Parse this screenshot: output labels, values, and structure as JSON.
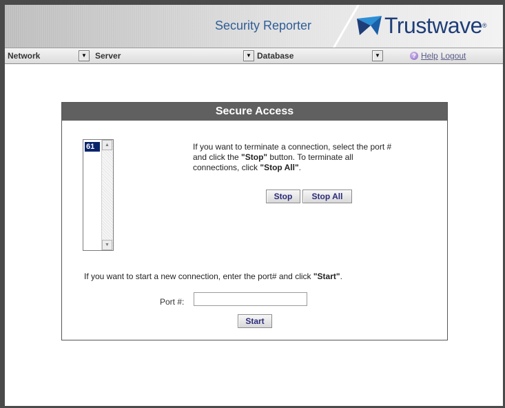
{
  "header": {
    "product_title": "Security Reporter",
    "brand": "Trustwave",
    "brand_mark": "trustwave-logo-mark",
    "brand_color": "#1e3e78"
  },
  "nav": {
    "menus": [
      {
        "label": "Network"
      },
      {
        "label": "Server"
      },
      {
        "label": "Database"
      }
    ],
    "help_label": "Help",
    "logout_label": "Logout"
  },
  "panel": {
    "title": "Secure Access",
    "connections": [
      "61"
    ],
    "instruction_parts": {
      "p1": "If you want to terminate a connection, select the port # and click the ",
      "b1": "\"Stop\"",
      "p2": " button. To terminate all connections, click ",
      "b2": "\"Stop All\"",
      "p3": "."
    },
    "stop_label": "Stop",
    "stop_all_label": "Stop All",
    "start_parts": {
      "p1": "If you want to start a new connection, enter the port# and click ",
      "b1": "\"Start\"",
      "p2": "."
    },
    "port_label": "Port #:",
    "port_value": "",
    "start_label": "Start"
  },
  "colors": {
    "panel_header": "#606060",
    "selected_item": "#0a246a",
    "button_text": "#2a2a7a"
  }
}
